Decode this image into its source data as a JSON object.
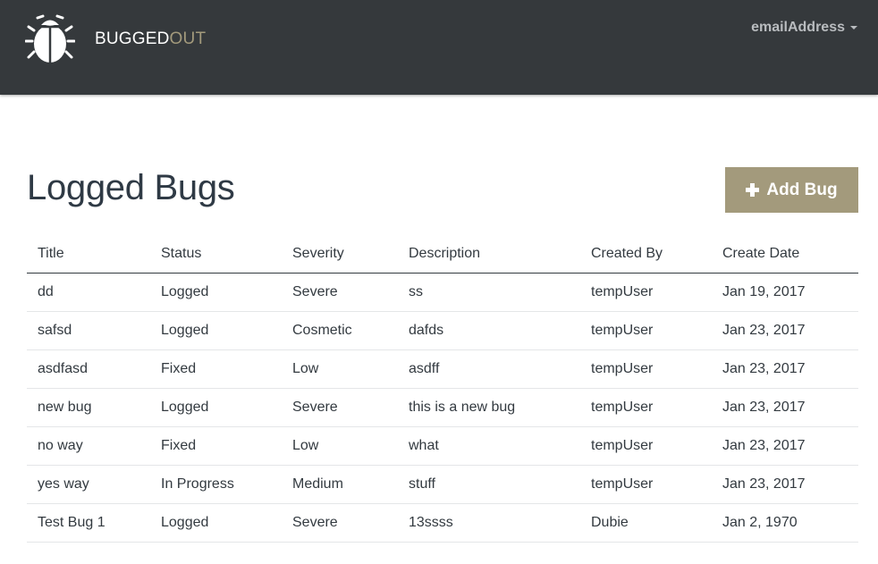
{
  "brand": {
    "name_part1": "BUGGED",
    "name_part2": "OUT",
    "logo_icon": "bug-icon"
  },
  "user_menu": {
    "label": "emailAddress"
  },
  "page": {
    "title": "Logged Bugs"
  },
  "add_bug_button": {
    "label": "Add Bug",
    "icon": "plus-icon"
  },
  "table": {
    "columns": [
      "Title",
      "Status",
      "Severity",
      "Description",
      "Created By",
      "Create Date"
    ],
    "rows": [
      [
        "dd",
        "Logged",
        "Severe",
        "ss",
        "tempUser",
        "Jan 19, 2017"
      ],
      [
        "safsd",
        "Logged",
        "Cosmetic",
        "dafds",
        "tempUser",
        "Jan 23, 2017"
      ],
      [
        "asdfasd",
        "Fixed",
        "Low",
        "asdff",
        "tempUser",
        "Jan 23, 2017"
      ],
      [
        "new bug",
        "Logged",
        "Severe",
        "this is a new bug",
        "tempUser",
        "Jan 23, 2017"
      ],
      [
        "no way",
        "Fixed",
        "Low",
        "what",
        "tempUser",
        "Jan 23, 2017"
      ],
      [
        "yes way",
        "In Progress",
        "Medium",
        "stuff",
        "tempUser",
        "Jan 23, 2017"
      ],
      [
        "Test Bug 1",
        "Logged",
        "Severe",
        "13ssss",
        "Dubie",
        "Jan 2, 1970"
      ]
    ]
  },
  "colors": {
    "navbar_bg": "#35393c",
    "accent": "#a39a7c",
    "text": "#333a40"
  }
}
